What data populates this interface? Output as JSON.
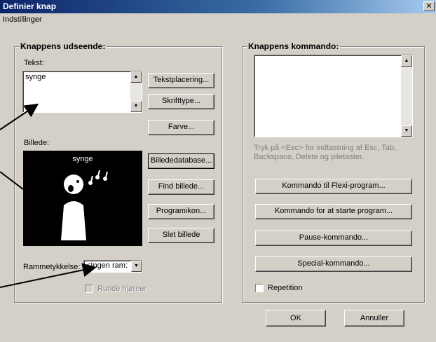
{
  "window": {
    "title": "Definier knap",
    "close_glyph": "✕"
  },
  "menu": {
    "label": "Indstillinger"
  },
  "appearance": {
    "group_title": "Knappens udseende:",
    "text_label": "Tekst:",
    "text_value": "synge",
    "buttons": {
      "text_placement": "Tekstplacering...",
      "font": "Skrifttype...",
      "color": "Farve...",
      "picture_db": "Billededatabase...",
      "find_picture": "Find billede...",
      "program_icon": "Programikon...",
      "delete_picture": "Slet billede"
    },
    "picture_label": "Billede:",
    "picture_caption": "synge",
    "border_label": "Rammetykkelse:",
    "border_value": "<Ingen ram:",
    "rounded_corners": "Runde hjørner"
  },
  "command": {
    "group_title": "Knappens kommando:",
    "hint": "Tryk på <Esc> for indtastning af Esc, Tab, Backspace, Delete og piletaster.",
    "buttons": {
      "flexi": "Kommando til Flexi-program...",
      "start_program": "Kommando for at starte program...",
      "pause": "Pause-kommando...",
      "special": "Special-kommando..."
    },
    "repetition": "Repetition"
  },
  "footer": {
    "ok": "OK",
    "cancel": "Annuller"
  },
  "colors": {
    "titlebar": "#0a246a",
    "face": "#d4d0c8",
    "annotation_arrows": "#000000"
  }
}
